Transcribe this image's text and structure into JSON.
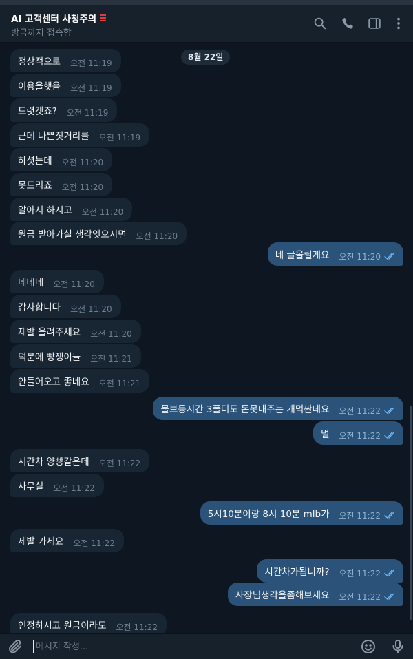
{
  "header": {
    "title": "AI 고객센터 사청주의",
    "status": "방금까지 접속함"
  },
  "date_separator": "8월 22일",
  "messages": [
    {
      "dir": "in",
      "text": "정상적으로",
      "time": "오전 11:19"
    },
    {
      "dir": "in",
      "text": "이용을햇음",
      "time": "오전 11:19"
    },
    {
      "dir": "in",
      "text": "드렷겟죠?",
      "time": "오전 11:19"
    },
    {
      "dir": "in",
      "text": "근데 나쁜짓거리를",
      "time": "오전 11:19"
    },
    {
      "dir": "in",
      "text": "하셧는데",
      "time": "오전 11:20"
    },
    {
      "dir": "in",
      "text": "못드리죠",
      "time": "오전 11:20"
    },
    {
      "dir": "in",
      "text": "알아서 하시고",
      "time": "오전 11:20"
    },
    {
      "dir": "in",
      "text": "원금 받아가실 생각잇으시면",
      "time": "오전 11:20"
    },
    {
      "dir": "out",
      "text": "네 글올릴게요",
      "time": "오전 11:20"
    },
    {
      "dir": "in",
      "text": "네네네",
      "time": "오전 11:20"
    },
    {
      "dir": "in",
      "text": "감사합니다",
      "time": "오전 11:20"
    },
    {
      "dir": "in",
      "text": "제발 올려주세요",
      "time": "오전 11:20"
    },
    {
      "dir": "in",
      "text": "덕분에 빵쟁이들",
      "time": "오전 11:21"
    },
    {
      "dir": "in",
      "text": "안들어오고 좋네요",
      "time": "오전 11:21"
    },
    {
      "dir": "out",
      "text": "물브동시간 3폴더도 돈못내주는 개먹싼데요",
      "time": "오전 11:22"
    },
    {
      "dir": "out",
      "text": "멀",
      "time": "오전 11:22"
    },
    {
      "dir": "in",
      "text": "시간차 양빵같은데",
      "time": "오전 11:22"
    },
    {
      "dir": "in",
      "text": "사무실",
      "time": "오전 11:22"
    },
    {
      "dir": "out",
      "text": "5시10분이랑 8시 10분 mlb가",
      "time": "오전 11:22"
    },
    {
      "dir": "in",
      "text": "제발 가세요",
      "time": "오전 11:22"
    },
    {
      "dir": "out",
      "text": "시간차가됩니까?",
      "time": "오전 11:22"
    },
    {
      "dir": "out",
      "text": "사장님생각을좀해보세요",
      "time": "오전 11:22"
    },
    {
      "dir": "in",
      "text": "인정하시고 원금이라도",
      "time": "오전 11:22"
    }
  ],
  "composer": {
    "placeholder": "메시지 작성..."
  },
  "colors": {
    "background": "#0e1621",
    "header": "#17212b",
    "incoming_bubble": "#182533",
    "outgoing_bubble": "#2b5278",
    "read_ticks": "#6ab3f3"
  }
}
